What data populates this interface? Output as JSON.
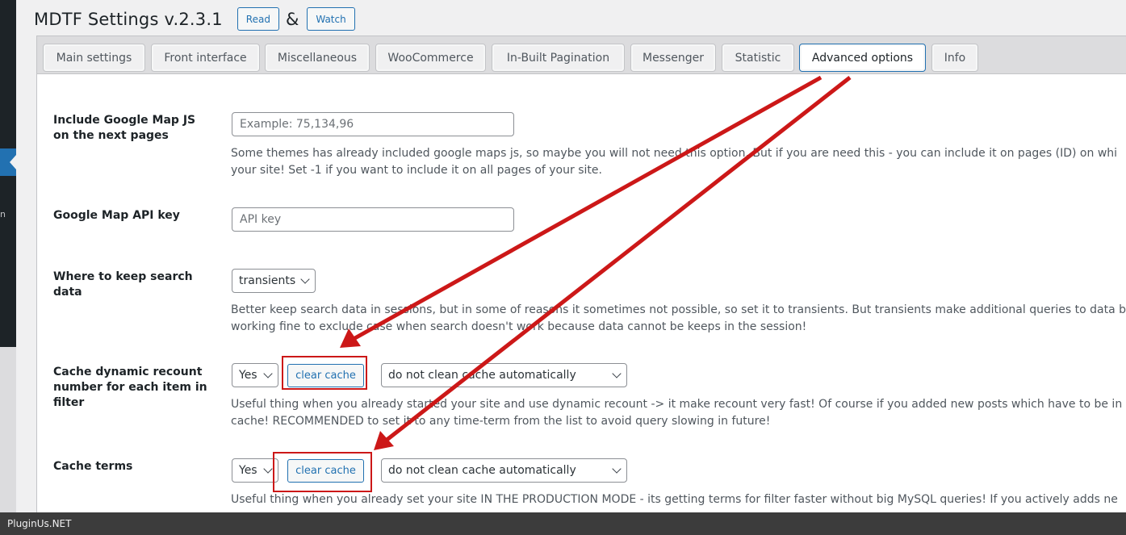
{
  "sidebar": {
    "fragment": "n"
  },
  "header": {
    "title": "MDTF Settings v.2.3.1",
    "read_label": "Read",
    "amp": "&",
    "watch_label": "Watch"
  },
  "tabs": [
    {
      "label": "Main settings"
    },
    {
      "label": "Front interface"
    },
    {
      "label": "Miscellaneous"
    },
    {
      "label": "WooCommerce"
    },
    {
      "label": "In-Built Pagination"
    },
    {
      "label": "Messenger"
    },
    {
      "label": "Statistic"
    },
    {
      "label": "Advanced options"
    },
    {
      "label": "Info"
    }
  ],
  "active_tab": "Advanced options",
  "settings": {
    "google_map_js": {
      "label_line1": "Include Google Map JS",
      "label_line2": "on the next pages",
      "placeholder": "Example: 75,134,96",
      "desc_line1": "Some themes has already included google maps js, so maybe you will not need this option. But if you are need this - you can include it on pages (ID) on whi",
      "desc_line2": "your site! Set -1 if you want to include it on all pages of your site."
    },
    "google_map_api": {
      "label": "Google Map API key",
      "placeholder": "API key"
    },
    "search_data": {
      "label_line1": "Where to keep search",
      "label_line2": "data",
      "value": "transients",
      "desc_line1": "Better keep search data in sessions, but in some of reasons it sometimes not possible, so set it to transients. But transients make additional queries to data b",
      "desc_line2": "working fine to exclude case when search doesn't work because data cannot be keeps in the session!"
    },
    "cache_recount": {
      "label_line1": "Cache dynamic recount",
      "label_line2": "number for each item in",
      "label_line3": "filter",
      "value": "Yes",
      "clear_label": "clear cache",
      "period": "do not clean cache automatically",
      "desc_line1": "Useful thing when you already started your site and use dynamic recount -> it make recount very fast! Of course if you added new posts which have to be in",
      "desc_line2": "cache! RECOMMENDED to set it to any time-term from the list to avoid query slowing in future!"
    },
    "cache_terms": {
      "label": "Cache terms",
      "value": "Yes",
      "clear_label": "clear cache",
      "period": "do not clean cache automatically",
      "desc_line1": "Useful thing when you already set your site IN THE PRODUCTION MODE - its getting terms for filter faster without big MySQL queries! If you actively adds ne"
    }
  },
  "annotation_color": "#cc1818",
  "footer": {
    "text": "PluginUs.NET"
  }
}
